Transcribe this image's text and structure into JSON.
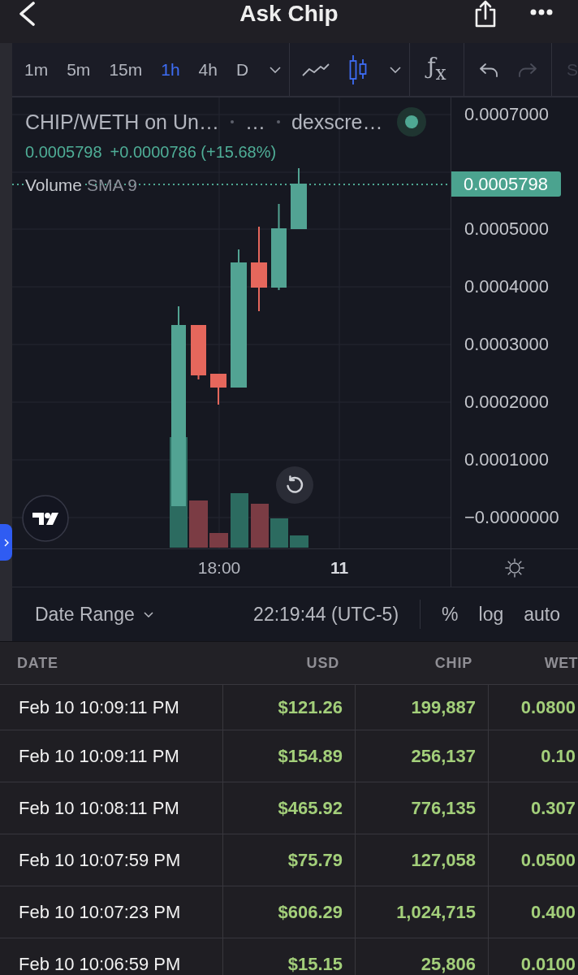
{
  "header": {
    "title": "Ask Chip"
  },
  "toolbar": {
    "intervals": [
      {
        "label": "1m",
        "selected": false
      },
      {
        "label": "5m",
        "selected": false
      },
      {
        "label": "15m",
        "selected": false
      },
      {
        "label": "1h",
        "selected": true
      },
      {
        "label": "4h",
        "selected": false
      },
      {
        "label": "D",
        "selected": false
      }
    ],
    "chart_styles": [
      {
        "kind": "line",
        "selected": false
      },
      {
        "kind": "candles",
        "selected": true
      }
    ],
    "indicators": "ƒ$_{x}$",
    "history": [
      {
        "kind": "undo",
        "disabled": false
      },
      {
        "kind": "redo",
        "disabled": true
      }
    ],
    "partial_item": "S"
  },
  "chart": {
    "legend": {
      "title_parts": [
        "CHIP/WETH on Un…",
        "…",
        "dexscre…"
      ],
      "price": "0.0005798",
      "change": "+0.0000786 (+15.68%)",
      "indicator": "Volume",
      "indicator_params": "SMA 9"
    },
    "price_axis": [
      "0.0007000",
      "0.0005000",
      "0.0004000",
      "0.0003000",
      "0.0002000",
      "0.0001000",
      "−0.0000000"
    ],
    "last_price": "0.0005798",
    "time_axis": [
      {
        "label": "18:00",
        "bold": false
      },
      {
        "label": "11",
        "bold": true
      }
    ]
  },
  "bottom_bar": {
    "date_range": "Date Range",
    "clock": "22:19:44 (UTC-5)",
    "scale_options": [
      "%",
      "log",
      "auto"
    ]
  },
  "trades": {
    "columns": [
      "DATE",
      "USD",
      "CHIP",
      "WET"
    ],
    "rows": [
      [
        "Feb 10 10:09:11 PM",
        "$121.26",
        "199,887",
        "0.0800"
      ],
      [
        "Feb 10 10:09:11 PM",
        "$154.89",
        "256,137",
        "0.10"
      ],
      [
        "Feb 10 10:08:11 PM",
        "$465.92",
        "776,135",
        "0.307"
      ],
      [
        "Feb 10 10:07:59 PM",
        "$75.79",
        "127,058",
        "0.0500"
      ],
      [
        "Feb 10 10:07:23 PM",
        "$606.29",
        "1,024,715",
        "0.400"
      ],
      [
        "Feb 10 10:06:59 PM",
        "$15.15",
        "25,806",
        "0.0100"
      ]
    ]
  }
}
